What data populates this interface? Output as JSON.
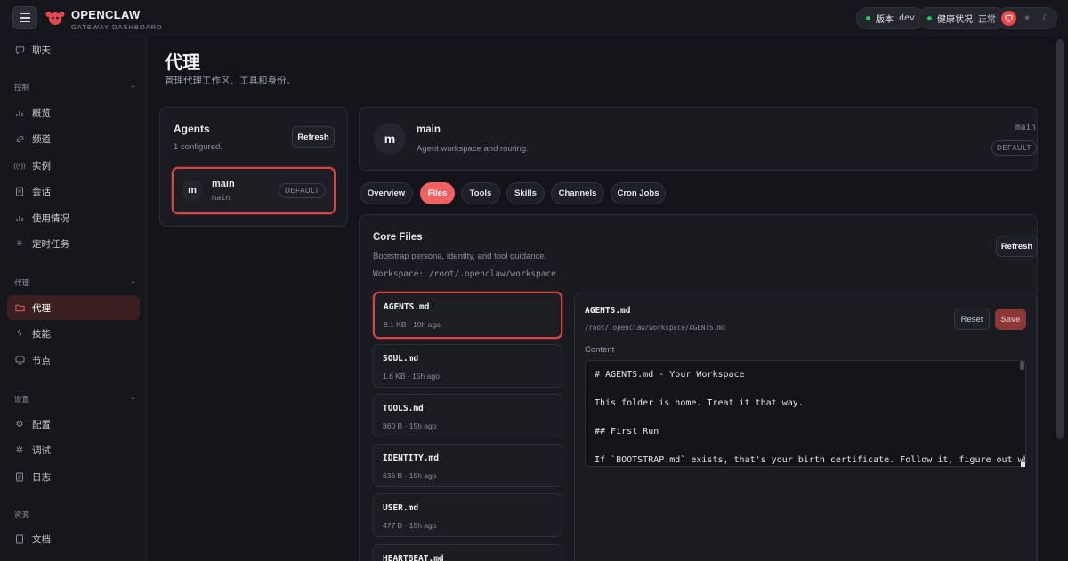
{
  "app": {
    "title": "OPENCLAW",
    "subtitle": "GATEWAY DASHBOARD"
  },
  "header": {
    "version_label": "版本",
    "version_value": "dev",
    "health_label": "健康状况",
    "health_value": "正常",
    "status_color": "#22c55e",
    "accent": "#ef4444"
  },
  "sidebar": {
    "chat": "聊天",
    "sections": [
      {
        "label": "控制",
        "collapse": "−"
      },
      {
        "label": "代理",
        "collapse": "−"
      },
      {
        "label": "设置",
        "collapse": "−"
      },
      {
        "label": "资源"
      }
    ],
    "control_items": [
      "概览",
      "频道",
      "实例",
      "会话",
      "使用情况",
      "定时任务"
    ],
    "agent_items": [
      "代理",
      "技能",
      "节点"
    ],
    "settings_items": [
      "配置",
      "调试",
      "日志"
    ],
    "resource_items": [
      "文档"
    ]
  },
  "page": {
    "title": "代理",
    "subtitle": "管理代理工作区、工具和身份。"
  },
  "agents_panel": {
    "title": "Agents",
    "count": "1 configured.",
    "refresh": "Refresh",
    "agent": {
      "initial": "m",
      "name": "main",
      "id": "main",
      "badge": "DEFAULT"
    }
  },
  "agent_header": {
    "initial": "m",
    "name": "main",
    "description": "Agent workspace and routing.",
    "id": "main",
    "badge": "DEFAULT"
  },
  "tabs": [
    "Overview",
    "Files",
    "Tools",
    "Skills",
    "Channels",
    "Cron Jobs"
  ],
  "active_tab": "Files",
  "core_files": {
    "title": "Core Files",
    "subtitle": "Bootstrap persona, identity, and tool guidance.",
    "workspace": "Workspace: /root/.openclaw/workspace",
    "refresh": "Refresh",
    "files": [
      {
        "name": "AGENTS.md",
        "meta": "8.1 KB · 10h ago"
      },
      {
        "name": "SOUL.md",
        "meta": "1.6 KB · 15h ago"
      },
      {
        "name": "TOOLS.md",
        "meta": "860 B · 15h ago"
      },
      {
        "name": "IDENTITY.md",
        "meta": "636 B · 15h ago"
      },
      {
        "name": "USER.md",
        "meta": "477 B · 15h ago"
      },
      {
        "name": "HEARTBEAT.md",
        "meta": ""
      }
    ]
  },
  "editor": {
    "file_name": "AGENTS.md",
    "file_path": "/root/.openclaw/workspace/AGENTS.md",
    "reset": "Reset",
    "save": "Save",
    "content_label": "Content",
    "lines": [
      "# AGENTS.md - Your Workspace",
      "",
      "This folder is home. Treat it that way.",
      "",
      "## First Run",
      "",
      "If `BOOTSTRAP.md` exists, that's your birth certificate. Follow it, figure out who"
    ]
  }
}
